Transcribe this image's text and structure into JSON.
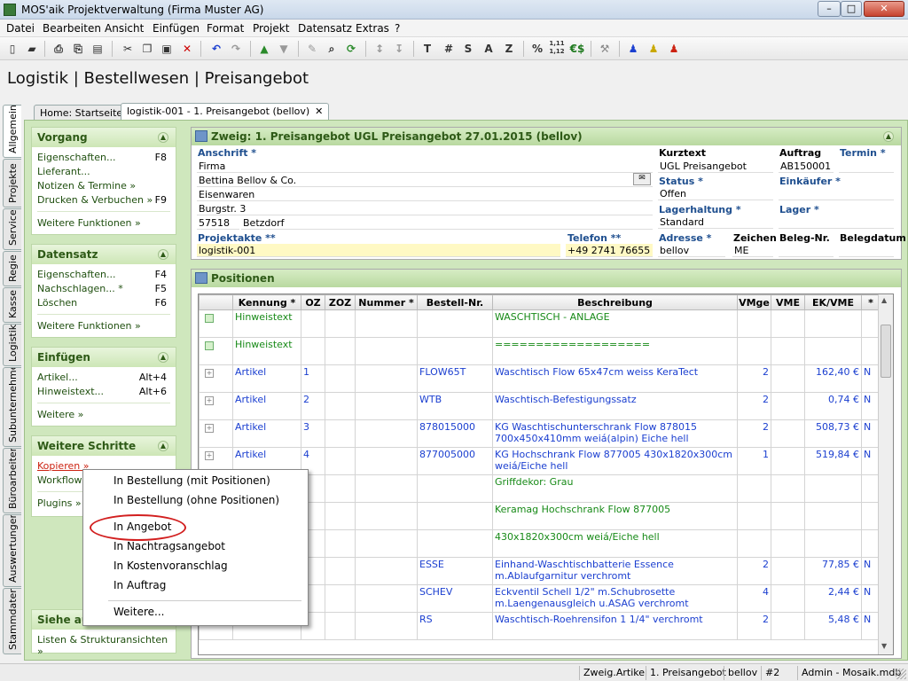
{
  "window": {
    "title": "MOS'aik Projektverwaltung (Firma Muster AG)",
    "buttons": {
      "min": "–",
      "max": "□",
      "close": "✕"
    }
  },
  "menu": [
    "Datei",
    "Bearbeiten",
    "Ansicht",
    "Einfügen",
    "Format",
    "Projekt",
    "Datensatz",
    "Extras",
    "?"
  ],
  "toolbar": {
    "text_buttons": [
      "T",
      "#",
      "S",
      "A",
      "Z",
      "%",
      "1,11\n1,12",
      "€$"
    ]
  },
  "page_title": "Logistik | Bestellwesen | Preisangebot",
  "tabs": [
    {
      "label": "Home: Startseite"
    },
    {
      "label": "logistik-001 - 1. Preisangebot (bellov)",
      "close": "✕"
    }
  ],
  "vertical_tabs": [
    "Allgemein",
    "Projekte",
    "Service",
    "Regie",
    "Kasse",
    "Logistik",
    "Subunternehmer",
    "Büroarbeiten",
    "Auswertungen",
    "Stammdaten"
  ],
  "sidebar": {
    "vorgang": {
      "title": "Vorgang",
      "items": [
        {
          "label": "Eigenschaften...",
          "key": "F8"
        },
        {
          "label": "Lieferant...",
          "key": ""
        },
        {
          "label": "Notizen & Termine »",
          "key": ""
        },
        {
          "label": "Drucken & Verbuchen »",
          "key": "F9"
        }
      ],
      "more": "Weitere Funktionen »"
    },
    "datensatz": {
      "title": "Datensatz",
      "items": [
        {
          "label": "Eigenschaften...",
          "key": "F4"
        },
        {
          "label": "Nachschlagen... *",
          "key": "F5"
        },
        {
          "label": "Löschen",
          "key": "F6"
        }
      ],
      "more": "Weitere Funktionen »"
    },
    "einfuegen": {
      "title": "Einfügen",
      "items": [
        {
          "label": "Artikel...",
          "key": "Alt+4"
        },
        {
          "label": "Hinweistext...",
          "key": "Alt+6"
        }
      ],
      "more": "Weitere »"
    },
    "weitere_schritte": {
      "title": "Weitere Schritte",
      "items": [
        "Kopieren »",
        "Workflow a",
        "Plugins »"
      ]
    },
    "siehe": {
      "title": "Siehe auc",
      "items": [
        "Listen & Strukturansichten »"
      ]
    }
  },
  "header_section": {
    "title": "Zweig: 1. Preisangebot UGL Preisangebot 27.01.2015 (bellov)",
    "labels": {
      "anschrift": "Anschrift *",
      "kurztext": "Kurztext",
      "auftrag": "Auftrag",
      "termin": "Termin *",
      "status": "Status *",
      "einkaeufer": "Einkäufer *",
      "lagerhaltung": "Lagerhaltung *",
      "lager": "Lager *",
      "projektakte": "Projektakte **",
      "telefon": "Telefon **",
      "adresse": "Adresse *",
      "zeichen": "Zeichen",
      "belegnr": "Beleg-Nr.",
      "belegdatum": "Belegdatum"
    },
    "values": {
      "address_lines": [
        "Firma",
        "Bettina Bellov & Co.",
        "Eisenwaren",
        "Burgstr. 3"
      ],
      "plz": "57518",
      "ort": "Betzdorf",
      "kurztext": "UGL Preisangebot",
      "auftrag": "AB150001",
      "termin": "",
      "status": "Offen",
      "einkaeufer": "",
      "lagerhaltung": "Standard",
      "lager": "",
      "projektakte": "logistik-001",
      "telefon": "+49 2741 76655",
      "adresse": "bellov",
      "zeichen": "ME",
      "belegnr": "",
      "belegdatum": ""
    }
  },
  "positions": {
    "title": "Positionen",
    "columns": [
      "",
      "Kennung *",
      "OZ",
      "ZOZ",
      "Nummer *",
      "Bestell-Nr.",
      "Beschreibung",
      "VMge",
      "VME",
      "EK/VME",
      "*"
    ],
    "rows": [
      {
        "box": "g",
        "kennung": "Hinweistext",
        "oz": "",
        "bestell": "",
        "desc": "WASCHTISCH - ANLAGE",
        "vmge": "",
        "ek": "",
        "flag": "",
        "type": "hint"
      },
      {
        "box": "g",
        "kennung": "Hinweistext",
        "oz": "",
        "bestell": "",
        "desc": "===================",
        "vmge": "",
        "ek": "",
        "flag": "",
        "type": "hint"
      },
      {
        "box": "p",
        "kennung": "Artikel",
        "oz": "1",
        "bestell": "FLOW65T",
        "desc": "Waschtisch Flow 65x47cm weiss KeraTect",
        "vmge": "2",
        "ek": "162,40 €",
        "flag": "N",
        "type": "art"
      },
      {
        "box": "p",
        "kennung": "Artikel",
        "oz": "2",
        "bestell": "WTB",
        "desc": "Waschtisch-Befestigungssatz",
        "vmge": "2",
        "ek": "0,74 €",
        "flag": "N",
        "type": "art"
      },
      {
        "box": "p",
        "kennung": "Artikel",
        "oz": "3",
        "bestell": "878015000",
        "desc": "KG Waschtischunterschrank Flow 878015 700x450x410mm weiá(alpin) Eiche hell",
        "vmge": "2",
        "ek": "508,73 €",
        "flag": "N",
        "type": "art"
      },
      {
        "box": "p",
        "kennung": "Artikel",
        "oz": "4",
        "bestell": "877005000",
        "desc": "KG Hochschrank Flow 877005 430x1820x300cm weiá/Eiche hell",
        "vmge": "1",
        "ek": "519,84 €",
        "flag": "N",
        "type": "art"
      },
      {
        "box": "",
        "kennung": "",
        "oz": "",
        "bestell": "",
        "desc": "Griffdekor: Grau",
        "vmge": "",
        "ek": "",
        "flag": "",
        "type": "hint"
      },
      {
        "box": "",
        "kennung": "",
        "oz": "",
        "bestell": "",
        "desc": "Keramag Hochschrank Flow 877005",
        "vmge": "",
        "ek": "",
        "flag": "",
        "type": "hint"
      },
      {
        "box": "",
        "kennung": "",
        "oz": "",
        "bestell": "",
        "desc": "430x1820x300cm weiá/Eiche hell",
        "vmge": "",
        "ek": "",
        "flag": "",
        "type": "hint"
      },
      {
        "box": "",
        "kennung": "",
        "oz": "",
        "bestell": "ESSE",
        "desc": "Einhand-Waschtischbatterie Essence m.Ablaufgarnitur verchromt",
        "vmge": "2",
        "ek": "77,85 €",
        "flag": "N",
        "type": "art"
      },
      {
        "box": "",
        "kennung": "",
        "oz": "",
        "bestell": "SCHEV",
        "desc": "Eckventil Schell 1/2\" m.Schubrosette m.Laengenausgleich u.ASAG verchromt",
        "vmge": "4",
        "ek": "2,44 €",
        "flag": "N",
        "type": "art"
      },
      {
        "box": "",
        "kennung": "",
        "oz": "",
        "bestell": "RS",
        "desc": "Waschtisch-Roehrensifon 1 1/4\" verchromt",
        "vmge": "2",
        "ek": "5,48 €",
        "flag": "N",
        "type": "art"
      }
    ]
  },
  "context_menu": {
    "items": [
      "In Bestellung (mit Positionen)",
      "In Bestellung (ohne Positionen)",
      "In Angebot",
      "In Nachtragsangebot",
      "In Kostenvoranschlag",
      "In Auftrag",
      "Weitere..."
    ],
    "highlighted": "In Angebot"
  },
  "statusbar": [
    "Zweig.Artikel",
    "1. Preisangebot",
    "bellov",
    "#2",
    "Admin - Mosaik.mdb"
  ],
  "colors": {
    "accent_green": "#2e5a17",
    "link_blue": "#1b3fd0",
    "text_green": "#178a17",
    "highlight_red": "#d21f1f"
  }
}
